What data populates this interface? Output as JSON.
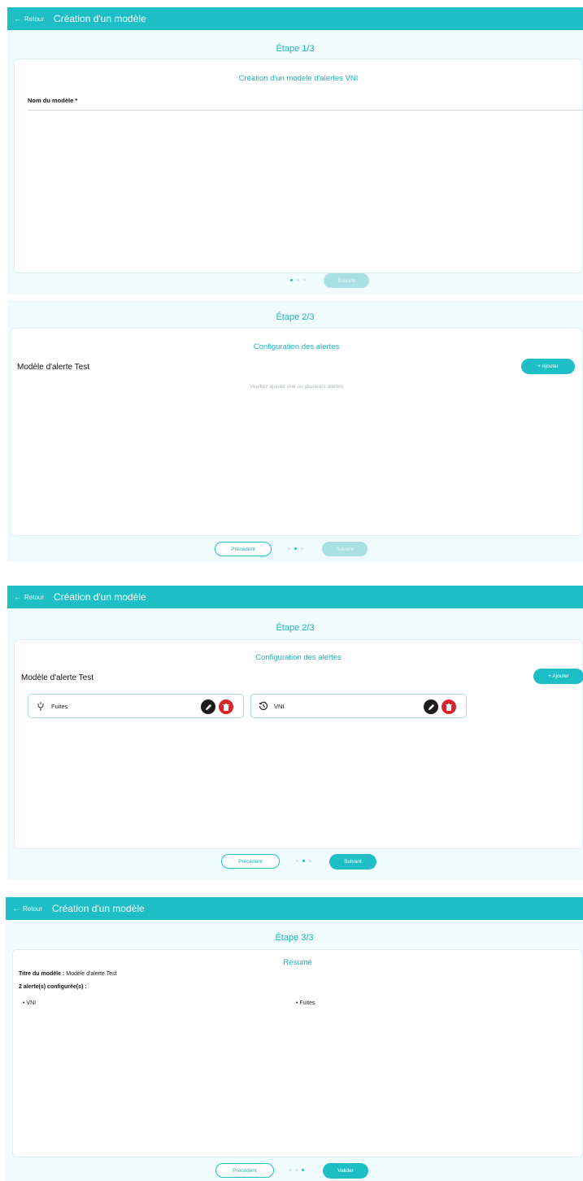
{
  "app": {
    "back_label": "Retour",
    "title": "Création d'un modèle"
  },
  "step1": {
    "step_label": "Étape 1/3",
    "card_title": "Création d'un modèle d'alertes VNI",
    "field_label": "Nom du modèle *",
    "field_value": "",
    "next_label": "Suivant"
  },
  "step2_empty": {
    "step_label": "Étape 2/3",
    "card_title": "Configuration des alertes",
    "model_name": "Modèle d'alerte Test",
    "add_label": "+ Ajouter",
    "hint": "Veuillez ajouter une ou plusieurs alertes",
    "prev_label": "Précédent",
    "next_label": "Suivant"
  },
  "step2_filled": {
    "step_label": "Étape 2/3",
    "card_title": "Configuration des alertes",
    "model_name": "Modèle d'alerte Test",
    "add_label": "+ Ajouter",
    "alerts": [
      {
        "name": "Fuites",
        "icon": "leak-icon"
      },
      {
        "name": "VNI",
        "icon": "history-icon"
      }
    ],
    "prev_label": "Précédent",
    "next_label": "Suivant"
  },
  "step3": {
    "step_label": "Étape 3/3",
    "card_title": "Résumé",
    "title_label": "Titre du modèle :",
    "title_value": "Modèle d'alerte Test",
    "count_label": "2 alerte(s) configurée(s) :",
    "items": [
      "VNI",
      "Fuites"
    ],
    "prev_label": "Précédent",
    "validate_label": "Valider"
  },
  "colors": {
    "accent": "#1dbec6",
    "accent_disabled": "#a9e0e4",
    "delete": "#d8252a",
    "panel_bg": "#f0fbfd"
  }
}
